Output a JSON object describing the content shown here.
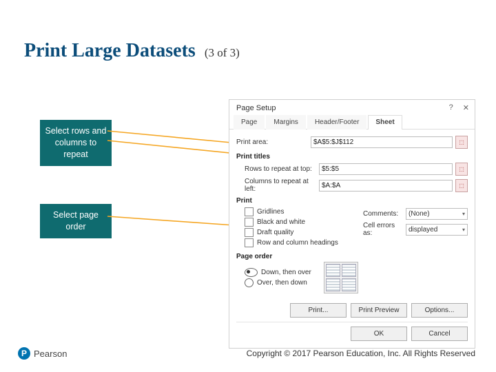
{
  "title": "Print Large Datasets",
  "subtitle": "(3 of 3)",
  "callouts": {
    "rowscols": "Select rows and columns to repeat",
    "pageorder": "Select page order"
  },
  "dialog": {
    "title": "Page Setup",
    "tabs": {
      "page": "Page",
      "margins": "Margins",
      "headerfooter": "Header/Footer",
      "sheet": "Sheet"
    },
    "printarea_label": "Print area:",
    "printarea_value": "$A$5:$J$112",
    "printtitles": "Print titles",
    "rows_label": "Rows to repeat at top:",
    "rows_value": "$5:$5",
    "cols_label": "Columns to repeat at left:",
    "cols_value": "$A:$A",
    "print_section": "Print",
    "gridlines": "Gridlines",
    "bw": "Black and white",
    "draft": "Draft quality",
    "rowcolhead": "Row and column headings",
    "comments_label": "Comments:",
    "comments_value": "(None)",
    "cellerrors_label": "Cell errors as:",
    "cellerrors_value": "displayed",
    "pageorder": "Page order",
    "down_then_over": "Down, then over",
    "over_then_down": "Over, then down",
    "buttons": {
      "print": "Print...",
      "preview": "Print Preview",
      "options": "Options...",
      "ok": "OK",
      "cancel": "Cancel"
    }
  },
  "footer": {
    "brand": "Pearson",
    "copyright": "Copyright © 2017 Pearson Education, Inc. All Rights Reserved"
  }
}
